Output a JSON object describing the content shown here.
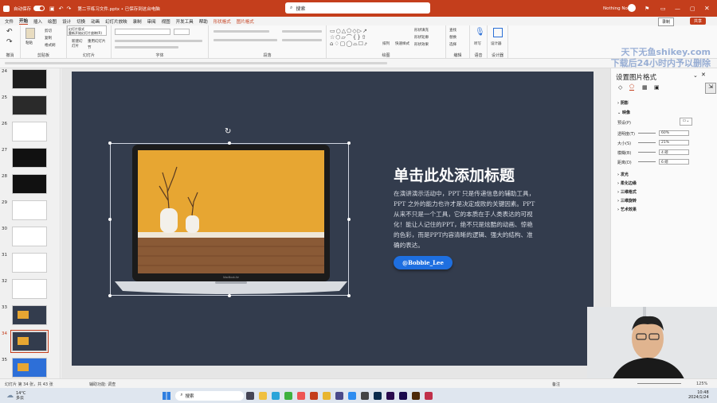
{
  "titlebar": {
    "autosave": "自动保存",
    "filename": "第二节练习文件.pptx • 已保存到这台电脑",
    "search": "搜索",
    "user": "Nothing No"
  },
  "menu": [
    "文件",
    "开始",
    "插入",
    "绘图",
    "设计",
    "切换",
    "动画",
    "幻灯片放映",
    "录制",
    "审阅",
    "视图",
    "开发工具",
    "帮助",
    "形状格式",
    "图片格式"
  ],
  "menu_active": "开始",
  "ribbon": {
    "groups": [
      "撤消",
      "剪贴板",
      "幻灯片",
      "字体",
      "段落",
      "绘图",
      "编辑",
      "语音",
      "设计器"
    ],
    "paste": "粘贴",
    "new_slide": "新建幻灯片",
    "reuse": "重用幻灯片",
    "section": "节",
    "cut": "剪切",
    "copy": "复制",
    "format_painter": "格式刷",
    "layout_tooltip_1": "幻灯片版式",
    "layout_tooltip_2": "重新开始幻灯片放映(R)",
    "shape_fill": "形状填充",
    "shape_outline": "形状轮廓",
    "shape_effect": "形状效果",
    "arrange": "排列",
    "quick_styles": "快速样式",
    "find": "查找",
    "replace": "替换",
    "select": "选择",
    "dictate": "听写",
    "designer": "设计器",
    "record": "录制",
    "share": "共享"
  },
  "watermark": {
    "line1": "天下无鱼shikey.com",
    "line2": "下载后24小时内予以删除"
  },
  "slide_numbers": [
    "24",
    "25",
    "26",
    "27",
    "28",
    "29",
    "30",
    "31",
    "32",
    "33",
    "34",
    "35"
  ],
  "selected_slide": "34",
  "slide": {
    "title": "单击此处添加标题",
    "body": "在演讲演示活动中，PPT 只是传递信息的辅助工具，PPT 之外的能力也许才是决定成败的关键因素。PPT从来不只是一个工具，它的本质在于人类表达的可视化！能让人记住的PPT，绝不只是炫酷的动画、惊艳的色彩，而是PPT内容清晰的逻辑、强大的结构、准确的表达。",
    "button": "@Bobbie_Lee",
    "laptop_brand": "MacBook Air"
  },
  "pane": {
    "title": "设置图片格式",
    "sections": [
      "阴影",
      "映像",
      "发光",
      "柔化边缘",
      "三维格式",
      "三维旋转",
      "艺术效果"
    ],
    "preset_label": "预设(P)",
    "props": [
      {
        "label": "透明度(T)",
        "value": "60%"
      },
      {
        "label": "大小(S)",
        "value": "21%"
      },
      {
        "label": "模糊(B)",
        "value": "4 磅"
      },
      {
        "label": "距离(D)",
        "value": "6 磅"
      }
    ]
  },
  "status": {
    "slide_info": "幻灯片 第 34 张，共 43 张",
    "notes": "备注",
    "accessibility": "辅助功能: 调查",
    "zoom": "125%"
  },
  "taskbar": {
    "temp": "14°C",
    "weather": "多云",
    "search": "搜索",
    "time": "10:48",
    "date": "2024/1/24"
  }
}
